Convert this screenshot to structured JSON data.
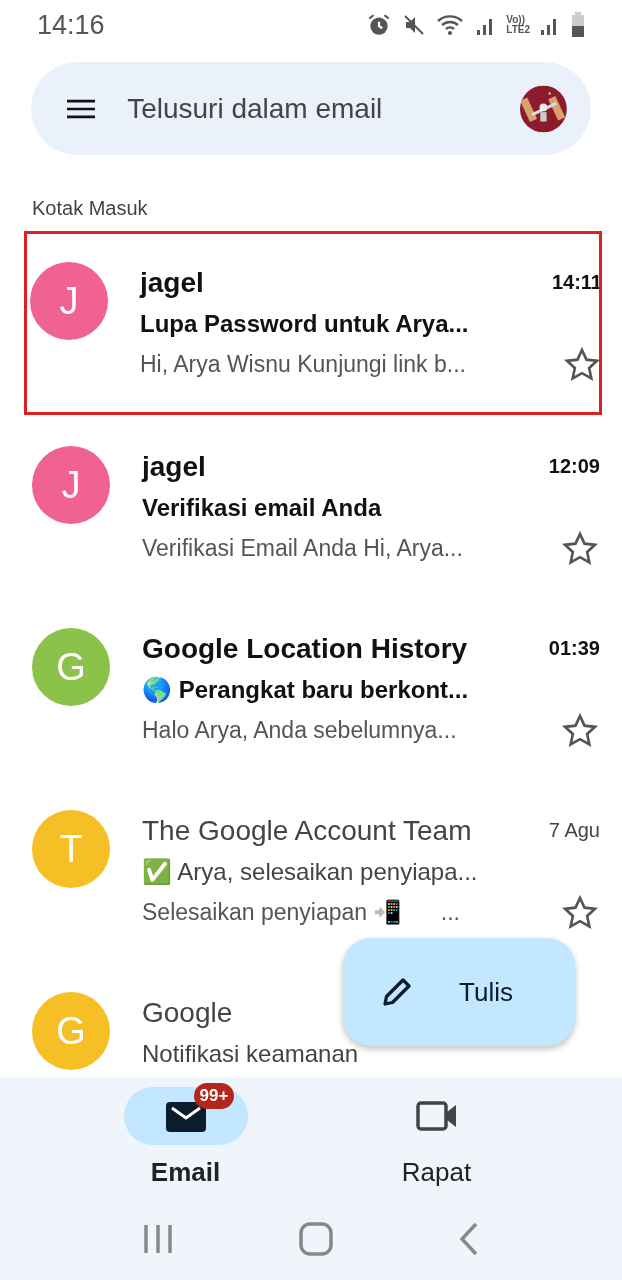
{
  "status_bar": {
    "time": "14:16",
    "network_label": "Vo))\nLTE2"
  },
  "search": {
    "placeholder": "Telusuri dalam email"
  },
  "section_title": "Kotak Masuk",
  "emails": [
    {
      "avatar_letter": "J",
      "color": "#f06292",
      "sender": "jagel",
      "time": "14:11",
      "subject": "Lupa Password untuk Arya...",
      "snippet": "Hi, Arya Wisnu Kunjungi link b...",
      "unread": true,
      "starred": false,
      "outlined": true
    },
    {
      "avatar_letter": "J",
      "color": "#f06292",
      "sender": "jagel",
      "time": "12:09",
      "subject": "Verifikasi email Anda",
      "snippet": "Verifikasi Email Anda Hi, Arya...",
      "unread": true,
      "starred": false,
      "outlined": false
    },
    {
      "avatar_letter": "G",
      "color": "#8bc34a",
      "sender": "Google Location History",
      "time": "01:39",
      "subject": "🌎 Perangkat baru berkont...",
      "snippet": "Halo Arya, Anda sebelumnya...",
      "unread": true,
      "starred": false,
      "outlined": false
    },
    {
      "avatar_letter": "T",
      "color": "#f6bf26",
      "sender": "The Google Account Team",
      "time": "7 Agu",
      "subject": "✅ Arya, selesaikan penyiapa...",
      "snippet": "Selesaikan penyiapan 📲      ...",
      "unread": false,
      "starred": false,
      "outlined": false
    },
    {
      "avatar_letter": "G",
      "color": "#f6bf26",
      "sender": "Google",
      "subject": "Notifikasi keamanan",
      "unread": false,
      "outlined": false
    }
  ],
  "compose": {
    "label": "Tulis"
  },
  "bottom_nav": [
    {
      "kind": "mail",
      "label": "Email",
      "badge": "99+",
      "selected": true
    },
    {
      "kind": "video",
      "label": "Rapat",
      "selected": false
    }
  ]
}
